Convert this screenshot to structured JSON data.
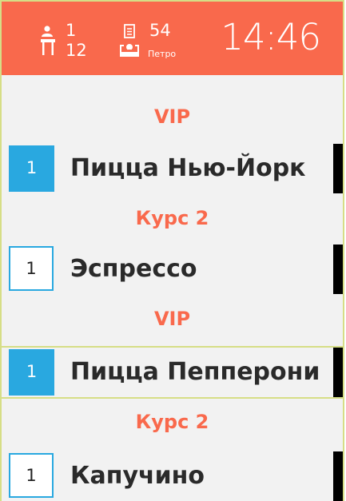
{
  "header": {
    "guests_count": "1",
    "table_number": "12",
    "order_number": "54",
    "waiter_name": "Петров",
    "clock": "14:46",
    "colors": {
      "header_bg": "#f9694c",
      "accent_blue": "#29a8e0",
      "section_text": "#f9694c",
      "border": "#d6de86"
    },
    "icons": [
      "waiter-person-icon",
      "table-icon",
      "receipt-icon",
      "server-tray-icon"
    ]
  },
  "order": [
    {
      "section": "VIP",
      "qty": "1",
      "name": "Пицца Нью-Йорк",
      "qty_style": "filled",
      "highlighted": false
    },
    {
      "section": "Курс 2",
      "qty": "1",
      "name": "Эспрессо",
      "qty_style": "outline",
      "highlighted": false
    },
    {
      "section": "VIP",
      "qty": "1",
      "name": "Пицца Пепперони",
      "qty_style": "filled",
      "highlighted": true
    },
    {
      "section": "Курс 2",
      "qty": "1",
      "name": "Капучино",
      "qty_style": "outline",
      "highlighted": false
    }
  ]
}
